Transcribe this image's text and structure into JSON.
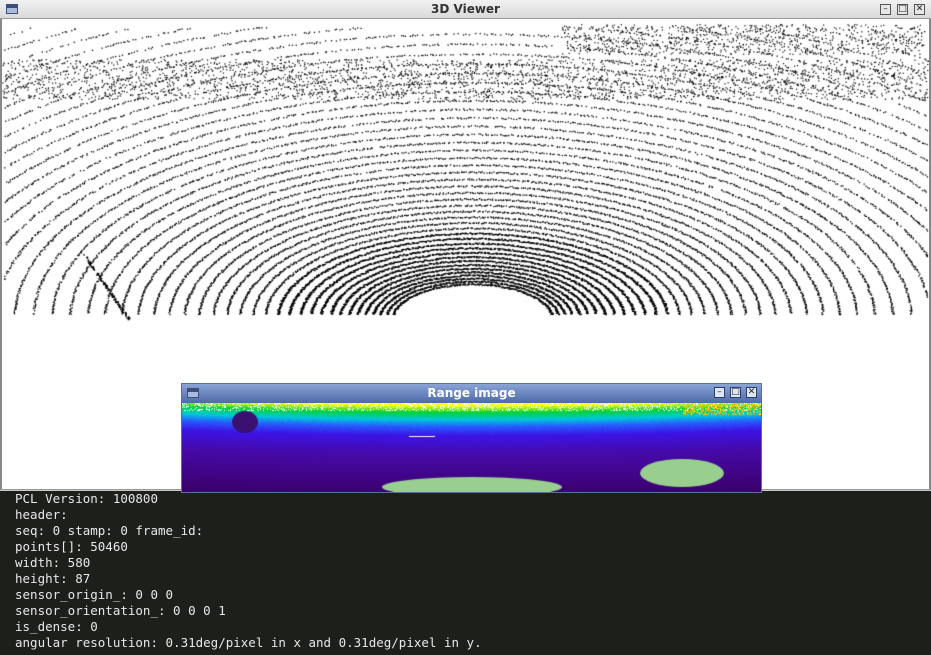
{
  "window": {
    "title": "3D Viewer",
    "buttons": {
      "minimize": "–",
      "maximize": "□",
      "close": "✕"
    }
  },
  "range_window": {
    "title": "Range image",
    "buttons": {
      "minimize": "–",
      "maximize": "□",
      "close": "✕"
    }
  },
  "console": {
    "lines": [
      "PCL Version: 100800",
      "header:",
      "seq: 0 stamp: 0 frame_id:",
      "points[]: 50460",
      "width: 580",
      "height: 87",
      "sensor_origin_: 0 0 0",
      "sensor_orientation_: 0 0 0 1",
      "is_dense: 0",
      "angular resolution: 0.31deg/pixel in x and 0.31deg/pixel in y."
    ]
  },
  "colors": {
    "console_bg": "#1d1f1b",
    "console_text": "#e8e8e8",
    "point": "#000000",
    "range_title_bg": "#4e6aa8"
  },
  "icons": {
    "window_menu": "window-menu-icon",
    "minimize": "minimize-icon",
    "maximize": "maximize-icon",
    "close": "close-icon"
  }
}
